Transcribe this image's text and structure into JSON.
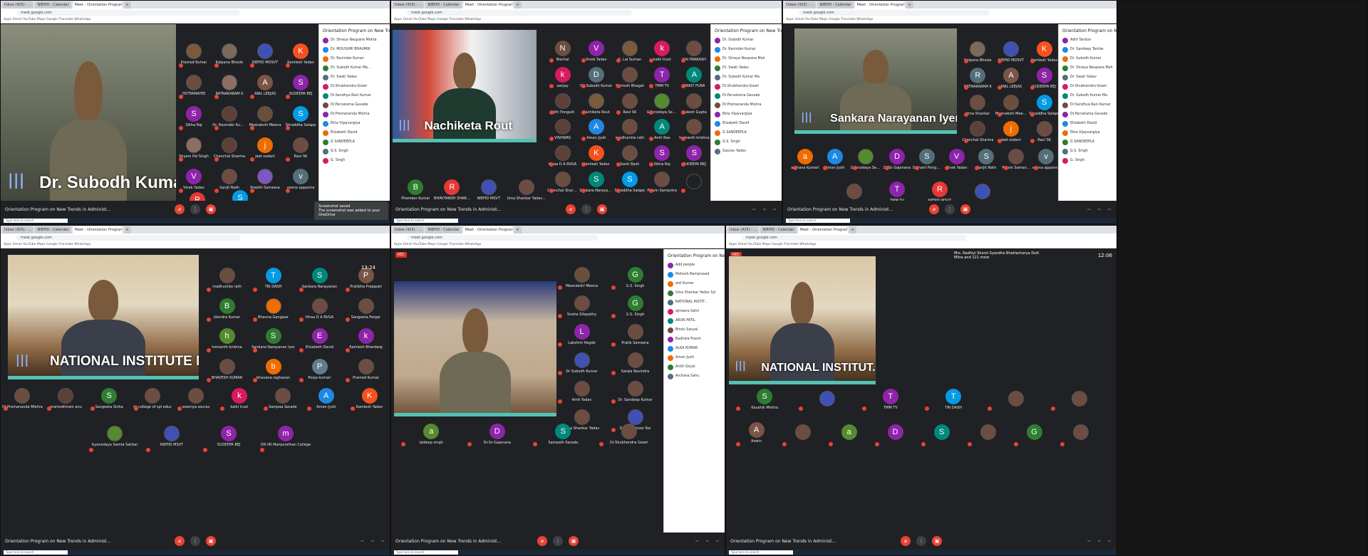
{
  "meeting_title": "Orientation Program on New Trends in Administ...",
  "side_panel_title": "Orientation Program on New Tren...",
  "tabs": [
    "Inbox (425) - ...",
    "NIEPID - Calendar",
    "Meet - Orientation Program",
    "+"
  ],
  "url": "meet.google.com",
  "bookmarks": "Apps  Gmail  YouTube  Maps  Google Translate  WhatsApp",
  "panels": {
    "p1": {
      "speaker": "Dr. Subodh Kumar...",
      "toast_title": "Screenshot saved",
      "toast_body": "The screenshot was added to your OneDrive",
      "participants": [
        {
          "name": "Pramod Kumar",
          "i": "",
          "c": "#7a5a3c"
        },
        {
          "name": "Kalpana Bhosle",
          "i": "",
          "c": "#7a6a5a"
        },
        {
          "name": "NIEPID MOSVT",
          "i": "",
          "c": "#3f51b5"
        },
        {
          "name": "Kamlesh Yadav",
          "i": "K",
          "c": "#f4511e"
        },
        {
          "name": "JYOTIRMAYEE",
          "i": "",
          "c": "#6d4c41"
        },
        {
          "name": "RATNAKARAM K",
          "i": "",
          "c": "#8d6e63"
        },
        {
          "name": "ANIL LEEJAS",
          "i": "A",
          "c": "#795548"
        },
        {
          "name": "SUDEEPA BEJ",
          "i": "S",
          "c": "#8e24aa"
        },
        {
          "name": "Sikha Raj",
          "i": "S",
          "c": "#8e24aa"
        },
        {
          "name": "Dr. Ravinder Kumar",
          "i": "",
          "c": "#5d4037"
        },
        {
          "name": "Meenakshi Meena",
          "i": "",
          "c": "#6a4f3b"
        },
        {
          "name": "Shraddha Salape",
          "i": "S",
          "c": "#039be5"
        },
        {
          "name": "Shyam Pal Singh",
          "i": "",
          "c": "#8d6e63"
        },
        {
          "name": "Chanchal Sharma",
          "i": "",
          "c": "#5d4037"
        },
        {
          "name": "jeet sodani",
          "i": "j",
          "c": "#ef6c00"
        },
        {
          "name": "Ravi SK",
          "i": "",
          "c": "#6d4c41"
        },
        {
          "name": "Vivek Yadav",
          "i": "V",
          "c": "#8e24aa"
        },
        {
          "name": "Sanjit Nath",
          "i": "",
          "c": "#6d4c41"
        },
        {
          "name": "Preethi Sameera",
          "i": "",
          "c": "#7e57c2"
        },
        {
          "name": "veena appanna",
          "i": "v",
          "c": "#546e7a"
        }
      ],
      "bottom_tiles": [
        {
          "name": "",
          "i": "R",
          "c": "#e53935"
        },
        {
          "name": "Santosh Kumar",
          "i": "S",
          "c": "#039be5"
        }
      ],
      "people": [
        "Dr. Shreya Neupane Mehta",
        "Dr. MOUSUMI BHAUMIK",
        "Dr. Ravinder Kumar",
        "Dr. Subodh Kumar Ma...",
        "Dr. Swati Yadav",
        "Dr.Shubhendra Gowri",
        "Dr.Sandhya Rani Kumar",
        "Dr.Parvatama Gavade",
        "Dr.Premananda Mishra",
        "Ekta Vijayvargiya",
        "Elizabeth David",
        "G SANDEEPLA",
        "G.S. Singh",
        "G. Singh"
      ]
    },
    "p2": {
      "speaker": "Nachiketa Rout",
      "participants": [
        {
          "name": "Nischal",
          "i": "N",
          "c": "#6d4c41"
        },
        {
          "name": "Vivek Yadav",
          "i": "V",
          "c": "#8e24aa"
        },
        {
          "name": "K. Lal Suman",
          "i": "",
          "c": "#7a5a3c"
        },
        {
          "name": "kalki trust",
          "i": "k",
          "c": "#d81b60"
        },
        {
          "name": "SAI PRAKASH",
          "i": "",
          "c": "#6d4c41"
        },
        {
          "name": "sanjay",
          "i": "k",
          "c": "#d81b60"
        },
        {
          "name": "Dr. Subodh Kumar",
          "i": "D",
          "c": "#546e7a"
        },
        {
          "name": "Santosh Bhagat",
          "i": "",
          "c": "#6d4c41"
        },
        {
          "name": "TMM TV",
          "i": "T",
          "c": "#8e24aa"
        },
        {
          "name": "ANKIT PURA",
          "i": "A",
          "c": "#00897b"
        },
        {
          "name": "Ajith Pongudi",
          "i": "",
          "c": "#5d4037"
        },
        {
          "name": "Nachiketa Rout",
          "i": "",
          "c": "#7a5a3c"
        },
        {
          "name": "Ravi SK",
          "i": "",
          "c": "#6d4c41"
        },
        {
          "name": "Gyanodaya Servic",
          "i": "",
          "c": "#558b2f"
        },
        {
          "name": "Rukesh Gupta",
          "i": "",
          "c": "#6d4c41"
        },
        {
          "name": "VISHWAS",
          "i": "",
          "c": "#5d4037"
        },
        {
          "name": "Aman Jyoti",
          "i": "A",
          "c": "#1e88e5"
        },
        {
          "name": "madhumita rath",
          "i": "",
          "c": "#6d4c41"
        },
        {
          "name": "Amit Rao",
          "i": "A",
          "c": "#00897b"
        },
        {
          "name": "hemanth krishna",
          "i": "",
          "c": "#6d4c41"
        },
        {
          "name": "Hiraa D A RVGA",
          "i": "",
          "c": "#5d4037"
        },
        {
          "name": "Kamlesh Yadav",
          "i": "K",
          "c": "#f4511e"
        },
        {
          "name": "Santi Bash",
          "i": "",
          "c": "#6d4c41"
        },
        {
          "name": "Sikha Raj",
          "i": "S",
          "c": "#8e24aa"
        },
        {
          "name": "SUDEEPA BEJ",
          "i": "S",
          "c": "#8e24aa"
        },
        {
          "name": "Chanchal Sharma",
          "i": "",
          "c": "#6d4c41"
        },
        {
          "name": "Sankara Narayanan",
          "i": "S",
          "c": "#00897b"
        },
        {
          "name": "Shraddha Salape",
          "i": "S",
          "c": "#039be5"
        },
        {
          "name": "Pravin Samantra",
          "i": "",
          "c": "#6d4c41"
        },
        {
          "name": "",
          "i": "",
          "c": "#202124"
        }
      ],
      "bottom_tiles": [
        {
          "name": "Pitamber Kumar",
          "i": "B",
          "c": "#2e7d32"
        },
        {
          "name": "BHAVYANSH SHARMA",
          "i": "R",
          "c": "#e53935"
        },
        {
          "name": "NIEPID MSVT",
          "i": "",
          "c": "#3f51b5"
        },
        {
          "name": "Uma Shankar Yadav Syl",
          "i": "",
          "c": "#6d4c41"
        }
      ],
      "people": [
        "Dr. Subodh Kumar",
        "Dr. Ravinder Kumar",
        "Dr. Shreya Neupane Meh",
        "Dr. Swati Yadav",
        "Dr. Subodh Kumar Ma",
        "Dr.Shubhendra Gowri",
        "Dr.Parvatama Gavade",
        "Dr.Premananda Mishra",
        "Ekta Vijayvargiya",
        "Elizabeth David",
        "G SANDEEPLA",
        "G.S. Singh",
        "Gaurav Yadav"
      ]
    },
    "p3": {
      "speaker": "Sankara Narayanan Iyer",
      "participants": [
        {
          "name": "Kalpana Bhosle",
          "i": "",
          "c": "#7a6a5a"
        },
        {
          "name": "NIEPID MOSVT",
          "i": "",
          "c": "#3f51b5"
        },
        {
          "name": "Kamlesh Yadav",
          "i": "K",
          "c": "#f4511e"
        },
        {
          "name": "RATNAKARAM K",
          "i": "R",
          "c": "#546e7a"
        },
        {
          "name": "ANIL LEEJAS",
          "i": "A",
          "c": "#795548"
        },
        {
          "name": "SUDEEPA BEJ",
          "i": "S",
          "c": "#8e24aa"
        },
        {
          "name": "Uma Shankar",
          "i": "",
          "c": "#6d4c41"
        },
        {
          "name": "Meenakshi Meena",
          "i": "",
          "c": "#6a4f3b"
        },
        {
          "name": "Shraddha Salape",
          "i": "S",
          "c": "#039be5"
        },
        {
          "name": "Chanchal Sharma",
          "i": "",
          "c": "#5d4037"
        },
        {
          "name": "jeet sodani",
          "i": "j",
          "c": "#ef6c00"
        },
        {
          "name": "Ravi SK",
          "i": "",
          "c": "#6d4c41"
        }
      ],
      "row": [
        {
          "name": "archana Kumari",
          "i": "a",
          "c": "#ef6c00"
        },
        {
          "name": "Aman Jyoti",
          "i": "A",
          "c": "#1e88e5"
        },
        {
          "name": "Gyanodaya Servic",
          "i": "",
          "c": "#558b2f"
        },
        {
          "name": "Dr.Ss Gajanana",
          "i": "D",
          "c": "#8e24aa"
        },
        {
          "name": "Sumant Pongudi",
          "i": "S",
          "c": "#546e7a"
        },
        {
          "name": "Vivek Yadav",
          "i": "V",
          "c": "#8e24aa"
        },
        {
          "name": "Sanjit Nath",
          "i": "S",
          "c": "#546e7a"
        },
        {
          "name": "Pravin Samantra",
          "i": "",
          "c": "#6d4c41"
        },
        {
          "name": "veena appanna",
          "i": "v",
          "c": "#546e7a"
        }
      ],
      "bottom_tiles": [
        {
          "name": "",
          "i": "",
          "c": "#6d4c41"
        },
        {
          "name": "TMM TV",
          "i": "T",
          "c": "#8e24aa"
        },
        {
          "name": "NIEPID MSVT",
          "i": "R",
          "c": "#e53935"
        },
        {
          "name": "",
          "i": "",
          "c": "#3f51b5"
        }
      ],
      "people": [
        "Aditi Tandon",
        "Dr. Sandeep Tambe",
        "Dr. Subodh Kumar",
        "Dr. Shreya Neupane Meh",
        "Dr. Swati Yadav",
        "Dr.Shubhendra Gowri",
        "Dr. Subodh Kumar Ma",
        "Dr.Sandhya Rani Kumar",
        "Dr.Parvatama Gavade",
        "Elizabeth David",
        "Ekta Vijayvargiya",
        "G SANDEEPLA",
        "G.S. Singh",
        "G. Singh"
      ]
    },
    "p4": {
      "speaker": "NATIONAL INSTITUTE N...",
      "participants": [
        {
          "name": "madhumita rath",
          "i": "",
          "c": "#6d4c41"
        },
        {
          "name": "TRI DASH",
          "i": "T",
          "c": "#039be5"
        },
        {
          "name": "Sankara Narayanan",
          "i": "S",
          "c": "#00897b"
        },
        {
          "name": "Pratibha Prajapati",
          "i": "P",
          "c": "#795548"
        },
        {
          "name": "jitendra Kumar",
          "i": "B",
          "c": "#2e7d32"
        },
        {
          "name": "Bhavna Gangwar",
          "i": "",
          "c": "#ef6c00"
        },
        {
          "name": "Hiraa D A RVGA",
          "i": "",
          "c": "#6d4c41"
        },
        {
          "name": "Sangeeta Pargar",
          "i": "",
          "c": "#6d4c41"
        },
        {
          "name": "hemanth krishna",
          "i": "h",
          "c": "#558b2f"
        },
        {
          "name": "Sankara Narayanan Iyer",
          "i": "S",
          "c": "#2e7d32"
        },
        {
          "name": "Elizabeth David",
          "i": "E",
          "c": "#8e24aa"
        },
        {
          "name": "Kamlesh Bhardwaj",
          "i": "k",
          "c": "#8e24aa"
        },
        {
          "name": "BHAVESH KUMAR",
          "i": "",
          "c": "#6d4c41"
        },
        {
          "name": "bhavana raghavan",
          "i": "b",
          "c": "#ef6c00"
        },
        {
          "name": "Pooja kumari",
          "i": "P",
          "c": "#607d8b"
        },
        {
          "name": "Pramod Kumar",
          "i": "",
          "c": "#6d4c41"
        }
      ],
      "row": [
        {
          "name": "Dr.Premananda Mishra",
          "i": "",
          "c": "#6d4c41"
        },
        {
          "name": "pramodhiram anu",
          "i": "",
          "c": "#5d4037"
        },
        {
          "name": "Sangeeta Sinha",
          "i": "S",
          "c": "#2e7d32"
        },
        {
          "name": "dr college of spl educ",
          "i": "",
          "c": "#6d4c41"
        },
        {
          "name": "sowmya sourav",
          "i": "",
          "c": "#6d4c41"
        },
        {
          "name": "kalki trust",
          "i": "k",
          "c": "#d81b60"
        },
        {
          "name": "Sampaa Sarade",
          "i": "",
          "c": "#6d4c41"
        },
        {
          "name": "Aman Jyoti",
          "i": "A",
          "c": "#1e88e5"
        },
        {
          "name": "Kamlesh Yadav",
          "i": "K",
          "c": "#f4511e"
        }
      ],
      "bottom_tiles": [
        {
          "name": "Gyanodaya Samta Sahkar",
          "i": "",
          "c": "#558b2f"
        },
        {
          "name": "NIEPID MSVT",
          "i": "",
          "c": "#3f51b5"
        },
        {
          "name": "SUDEEPA BEJ",
          "i": "S",
          "c": "#8e24aa"
        },
        {
          "name": "DR.VR Manjunathan College",
          "i": "m",
          "c": "#8e24aa"
        }
      ],
      "clock": "13:24"
    },
    "p5": {
      "participants": [
        {
          "name": "Meenakshi Meena",
          "i": "",
          "c": "#6a4f3b"
        },
        {
          "name": "G.S. Singh",
          "i": "G",
          "c": "#2e7d32"
        },
        {
          "name": "Sneha Sitapathy",
          "i": "",
          "c": "#6d4c41"
        },
        {
          "name": "G.S. Singh",
          "i": "G",
          "c": "#2e7d32"
        },
        {
          "name": "Lakshmi Hegde",
          "i": "L",
          "c": "#8e24aa"
        },
        {
          "name": "Pratik Sameera",
          "i": "",
          "c": "#6d4c41"
        },
        {
          "name": "Dr Subodh Kumar",
          "i": "",
          "c": "#3f51b5"
        },
        {
          "name": "Sarala Ravindra",
          "i": "",
          "c": "#6d4c41"
        },
        {
          "name": "Amit Yadav",
          "i": "",
          "c": "#6d4c41"
        },
        {
          "name": "Dr. Sandeep Kumar",
          "i": "",
          "c": "#6d4c41"
        },
        {
          "name": "Uma Shankar Yadav",
          "i": "",
          "c": "#6d4c41"
        },
        {
          "name": "Dr.Satyamoor Rai",
          "i": "",
          "c": "#3f51b5"
        }
      ],
      "bottom_tiles": [
        {
          "name": "jaideep singh",
          "i": "a",
          "c": "#558b2f"
        },
        {
          "name": "Dr.Ss Gajanana",
          "i": "D",
          "c": "#8e24aa"
        },
        {
          "name": "Sampath Sarada",
          "i": "S",
          "c": "#00897b"
        },
        {
          "name": "Dr.Shubhendra Gowri",
          "i": "",
          "c": "#6d4c41"
        }
      ],
      "people_title": "Orientation Program on New Tr...",
      "people": [
        "Add people",
        "Mahesh Ramprasad",
        "anil Kumar",
        "Uma Shankar Yadav Syl",
        "NATIONAL INSTIT...",
        "ajmeera Sahil",
        "ARUN PATIL",
        "Bindu Sanyal",
        "Badhela Pravin",
        "ALKA KUMAR",
        "Aman Jyoti",
        "Ankit Goyal",
        "Archana Sahu"
      ],
      "rec": "REC"
    },
    "p6": {
      "speaker": "NATIONAL INSTITUT...",
      "clock": "12:06",
      "caption": "Mrs. Radhiyi Sherol Syandha Bhattacharya Dutt Mitra and 121 more",
      "rec": "REC",
      "row": [
        {
          "name": "Kaushik Mishra",
          "i": "S",
          "c": "#2e7d32"
        },
        {
          "name": "",
          "i": "",
          "c": "#3f51b5"
        },
        {
          "name": "TMM TV",
          "i": "T",
          "c": "#8e24aa"
        },
        {
          "name": "TRI DASH",
          "i": "T",
          "c": "#039be5"
        },
        {
          "name": "",
          "i": "",
          "c": "#6d4c41"
        },
        {
          "name": "",
          "i": "",
          "c": "#6d4c41"
        }
      ],
      "bottom_tiles": [
        {
          "name": "Aswin",
          "i": "A",
          "c": "#795548"
        },
        {
          "name": "",
          "i": "",
          "c": "#6d4c41"
        },
        {
          "name": "",
          "i": "a",
          "c": "#558b2f"
        },
        {
          "name": "",
          "i": "D",
          "c": "#8e24aa"
        },
        {
          "name": "",
          "i": "S",
          "c": "#00897b"
        },
        {
          "name": "",
          "i": "",
          "c": "#6d4c41"
        },
        {
          "name": "",
          "i": "G",
          "c": "#2e7d32"
        },
        {
          "name": "",
          "i": "",
          "c": "#6d4c41"
        }
      ]
    }
  }
}
